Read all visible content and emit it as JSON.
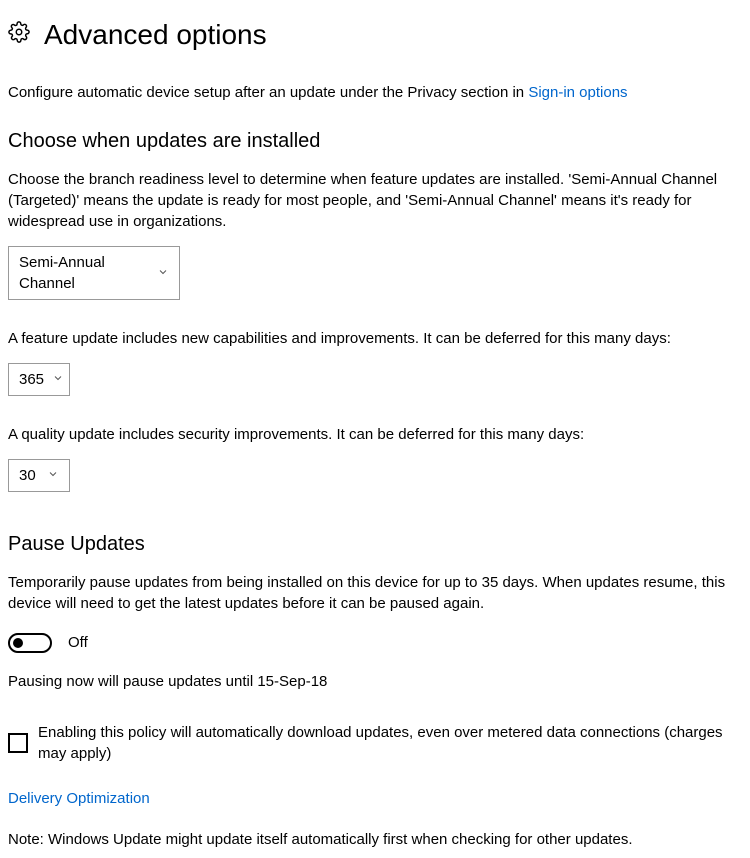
{
  "header": {
    "title": "Advanced options"
  },
  "intro": {
    "text_before": "Configure automatic device setup after an update under the Privacy section in ",
    "link_text": "Sign-in options"
  },
  "branch": {
    "heading": "Choose when updates are installed",
    "description": "Choose the branch readiness level to determine when feature updates are installed. 'Semi-Annual Channel (Targeted)' means the update is ready for most people, and 'Semi-Annual Channel' means it's ready for widespread use in organizations.",
    "selected": "Semi-Annual Channel"
  },
  "feature_defer": {
    "text": "A feature update includes new capabilities and improvements. It can be deferred for this many days:",
    "value": "365"
  },
  "quality_defer": {
    "text": "A quality update includes security improvements. It can be deferred for this many days:",
    "value": "30"
  },
  "pause": {
    "heading": "Pause Updates",
    "description": "Temporarily pause updates from being installed on this device for up to 35 days. When updates resume, this device will need to get the latest updates before it can be paused again.",
    "toggle_state": "Off",
    "until_text": "Pausing now will pause updates until 15-Sep-18"
  },
  "metered": {
    "label": "Enabling this policy will automatically download updates, even over metered data connections (charges may apply)"
  },
  "delivery": {
    "link_text": "Delivery Optimization"
  },
  "note": {
    "text": "Note: Windows Update might update itself automatically first when checking for other updates."
  }
}
